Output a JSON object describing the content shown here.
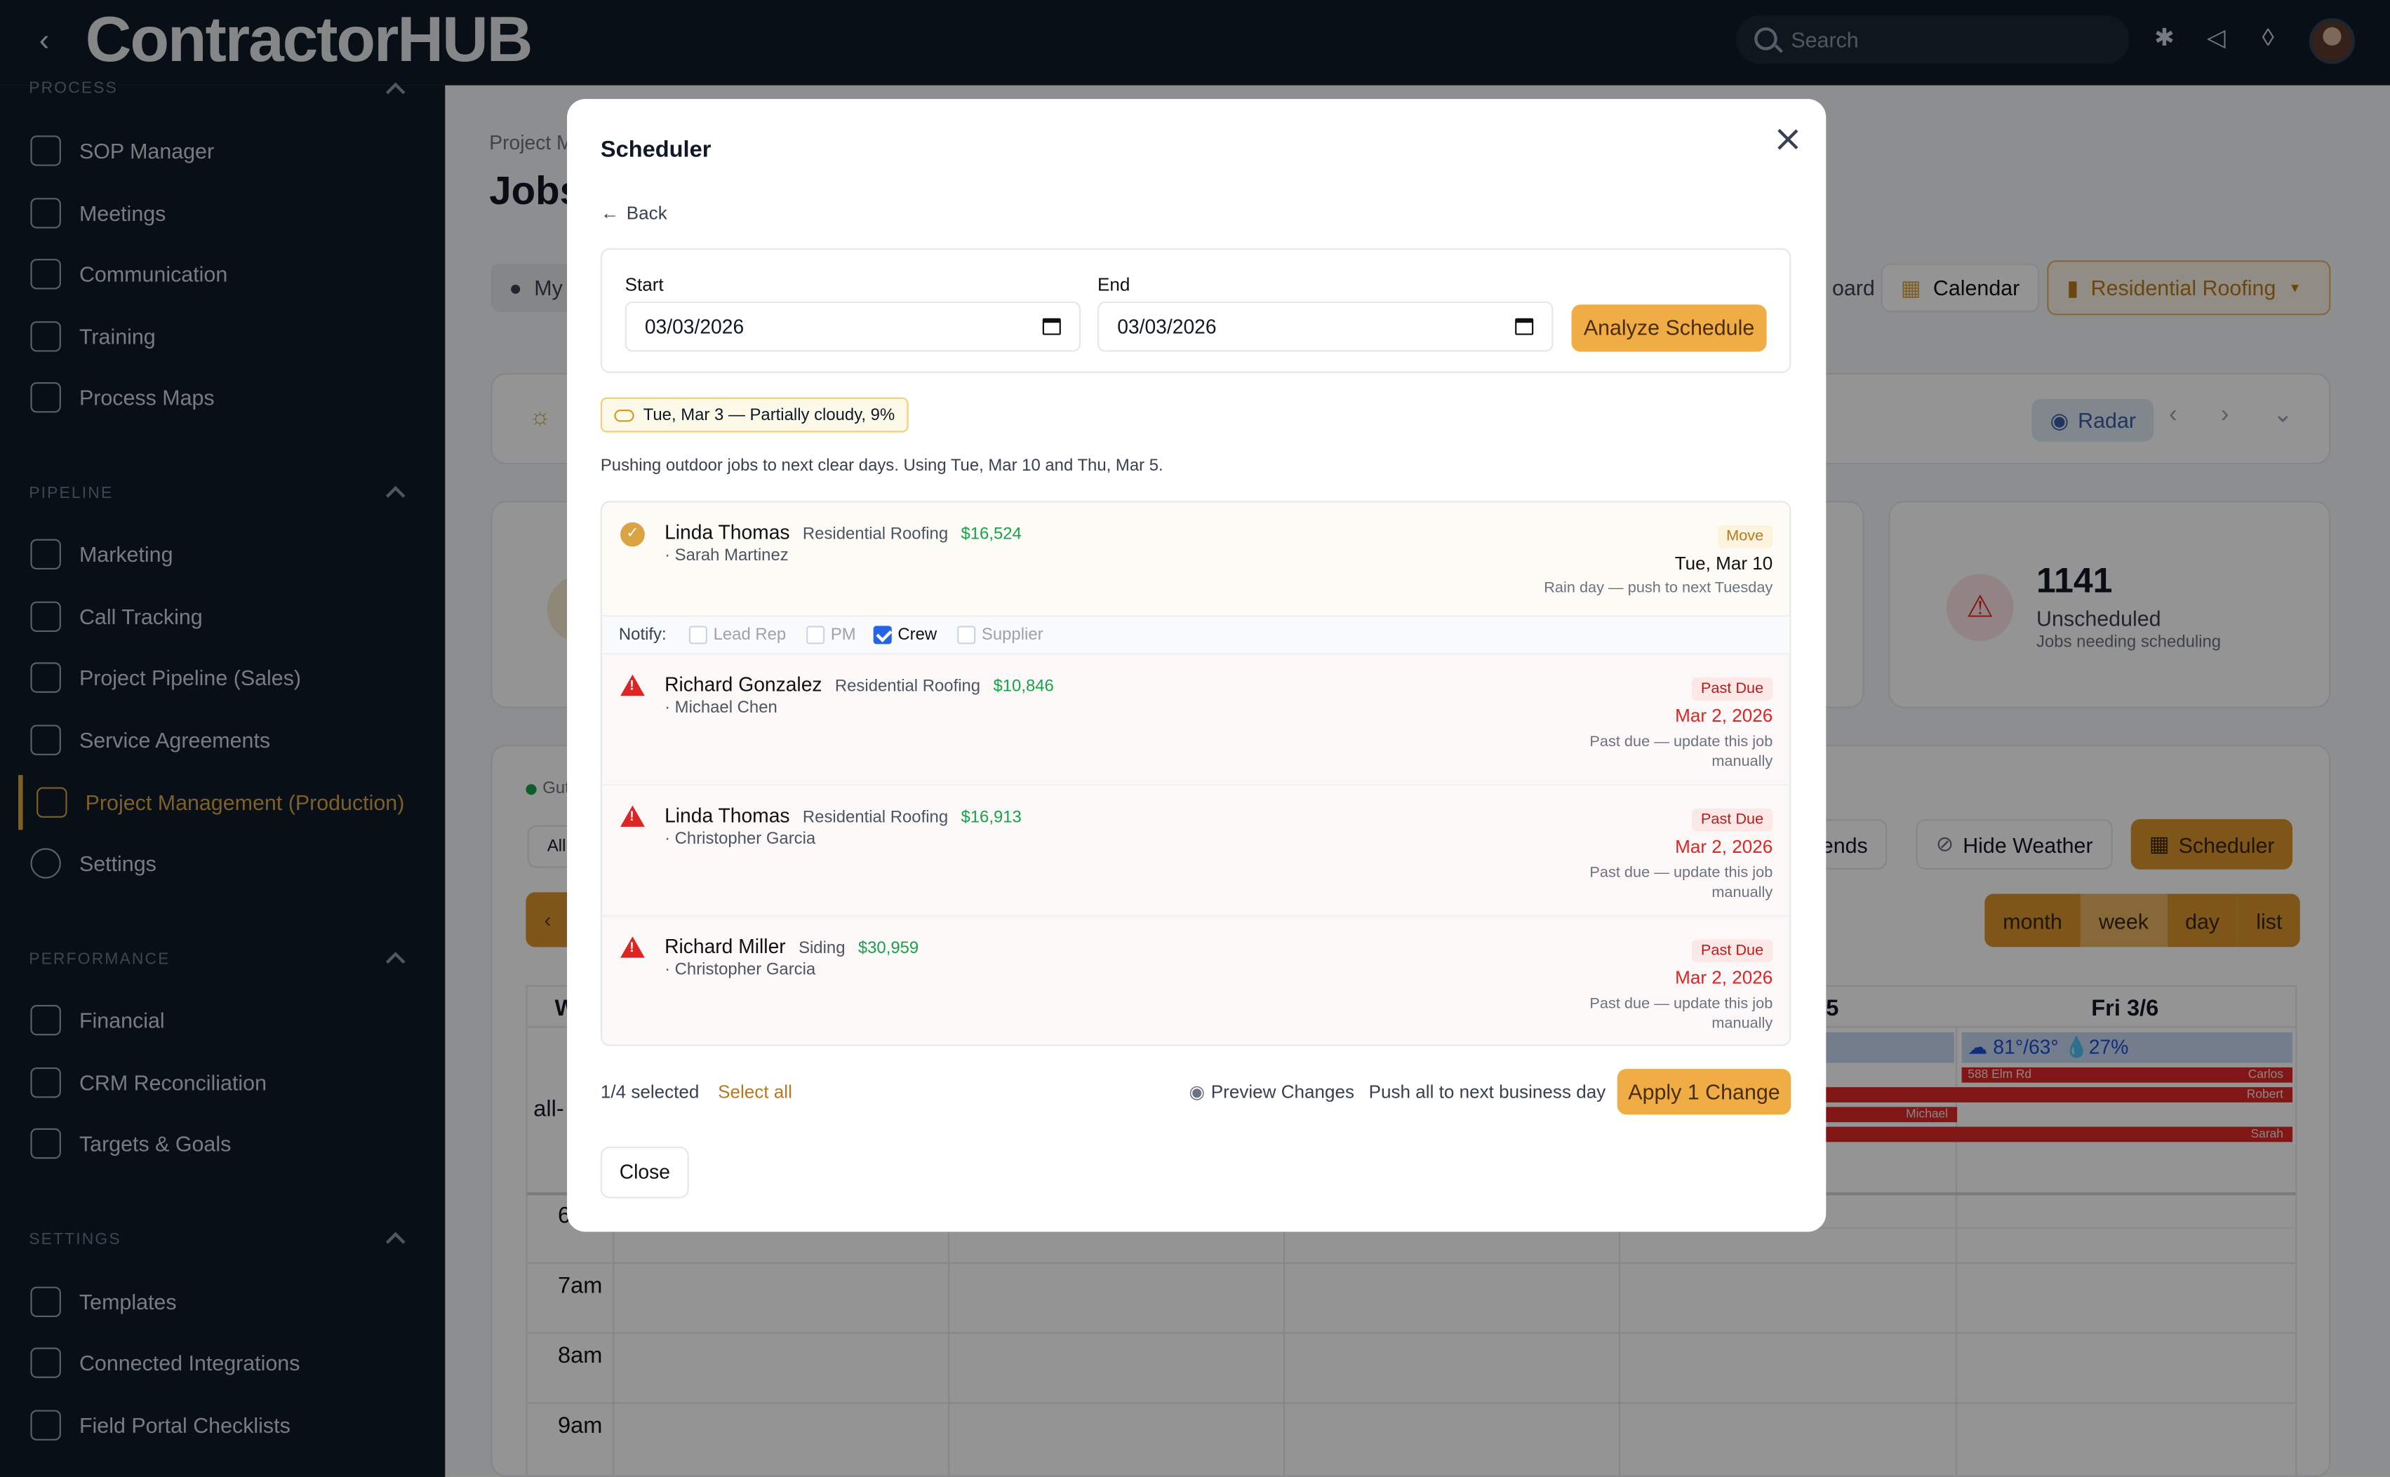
{
  "topbar": {
    "logo": "ContractorHUB",
    "search_placeholder": "Search"
  },
  "sidebar": {
    "sections": {
      "process": "PROCESS",
      "pipeline": "PIPELINE",
      "performance": "PERFORMANCE",
      "settings": "SETTINGS"
    },
    "items": [
      {
        "label": "SOP Manager",
        "icon": "document-icon"
      },
      {
        "label": "Meetings",
        "icon": "calendar-icon"
      },
      {
        "label": "Communication",
        "icon": "megaphone-icon"
      },
      {
        "label": "Training",
        "icon": "graduation-icon"
      },
      {
        "label": "Process Maps",
        "icon": "map-icon"
      },
      {
        "label": "Marketing",
        "icon": "megaphone-icon"
      },
      {
        "label": "Call Tracking",
        "icon": "phone-icon"
      },
      {
        "label": "Project Pipeline (Sales)",
        "icon": "briefcase-icon"
      },
      {
        "label": "Service Agreements",
        "icon": "shield-icon"
      },
      {
        "label": "Project Management (Production)",
        "icon": "calendar-icon",
        "active": true
      },
      {
        "label": "Settings",
        "icon": "gear-icon"
      },
      {
        "label": "Financial",
        "icon": "money-icon"
      },
      {
        "label": "CRM Reconciliation",
        "icon": "scale-icon"
      },
      {
        "label": "Targets & Goals",
        "icon": "flag-icon"
      },
      {
        "label": "Templates",
        "icon": "copy-icon"
      },
      {
        "label": "Connected Integrations",
        "icon": "arrows-icon"
      },
      {
        "label": "Field Portal Checklists",
        "icon": "clipboard-icon"
      }
    ]
  },
  "page": {
    "breadcrumb": "Project M",
    "title": "Jobs",
    "my_tab": "My",
    "board_tab": "oard",
    "calendar_tab": "Calendar",
    "filter_label": "Residential Roofing",
    "radar": "Radar",
    "stat_value": "1141",
    "stat_label": "Unscheduled",
    "stat_sub": "Jobs needing scheduling",
    "gut_label": "Gut",
    "all_label": "All",
    "weekends": "kends",
    "hide_weather": "Hide Weather",
    "scheduler_btn": "Scheduler",
    "views": [
      "month",
      "week",
      "day",
      "list"
    ],
    "day_header_w": "W",
    "day_header_5": "5",
    "day_header_fri": "Fri 3/6",
    "fri_weather": "81°/63°",
    "fri_rain": "27%",
    "allday": "all-",
    "hour_6": "6",
    "hours": [
      "7am",
      "8am",
      "9am"
    ],
    "events": [
      "588 Elm Rd",
      "Carlos",
      "Robert",
      "Michael",
      "Sarah"
    ]
  },
  "modal": {
    "title": "Scheduler",
    "back": "Back",
    "start_label": "Start",
    "start_value": "03/03/2026",
    "end_label": "End",
    "end_value": "03/03/2026",
    "analyze": "Analyze Schedule",
    "weather_chip": "Tue, Mar 3 — Partially cloudy, 9%",
    "note": "Pushing outdoor jobs to next clear days. Using Tue, Mar 10 and Thu, Mar 5.",
    "jobs": [
      {
        "name": "Linda Thomas",
        "type": "Residential Roofing",
        "amount": "$16,524",
        "person": "· Sarah Martinez",
        "tag": "Move",
        "date": "Tue, Mar 10",
        "reason": "Rain day — push to next Tuesday"
      },
      {
        "name": "Richard Gonzalez",
        "type": "Residential Roofing",
        "amount": "$10,846",
        "person": "· Michael Chen",
        "tag": "Past Due",
        "date": "Mar 2, 2026",
        "reason1": "Past due — update this job",
        "reason2": "manually"
      },
      {
        "name": "Linda Thomas",
        "type": "Residential Roofing",
        "amount": "$16,913",
        "person": "· Christopher Garcia",
        "tag": "Past Due",
        "date": "Mar 2, 2026",
        "reason1": "Past due — update this job",
        "reason2": "manually"
      },
      {
        "name": "Richard Miller",
        "type": "Siding",
        "amount": "$30,959",
        "person": "· Christopher Garcia",
        "tag": "Past Due",
        "date": "Mar 2, 2026",
        "reason1": "Past due — update this job",
        "reason2": "manually"
      }
    ],
    "notify_label": "Notify:",
    "notify": [
      "Lead Rep",
      "PM",
      "Crew",
      "Supplier"
    ],
    "selected": "1/4 selected",
    "select_all": "Select all",
    "preview": "Preview Changes",
    "push_all": "Push all to next business day",
    "apply": "Apply 1 Change",
    "close": "Close"
  },
  "colors": {
    "accent": "#f0ad46",
    "gold": "#d9a441",
    "danger": "#dc2626",
    "money": "#16a34a"
  }
}
